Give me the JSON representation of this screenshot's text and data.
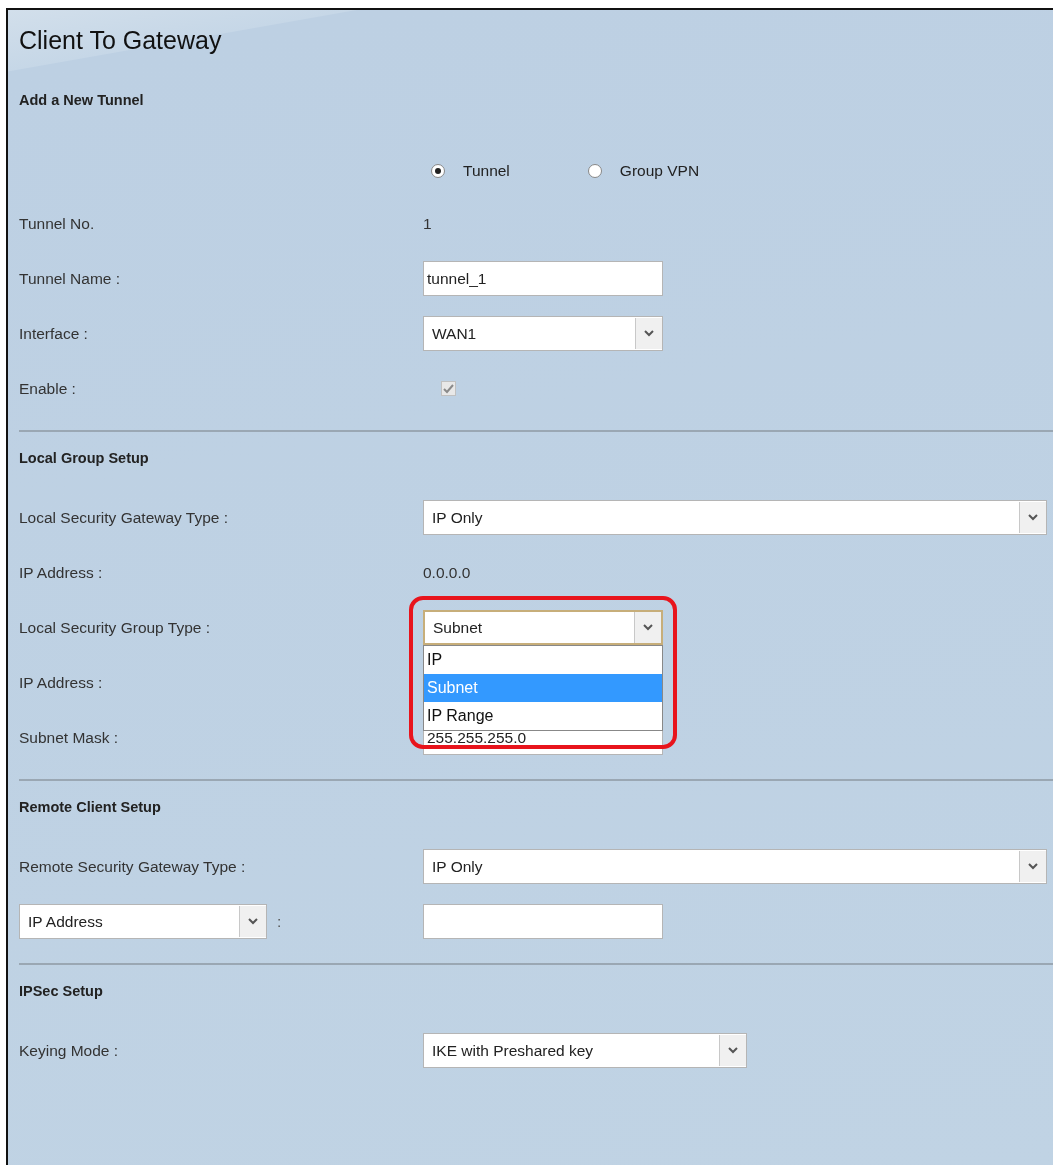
{
  "page": {
    "title": "Client To Gateway"
  },
  "sections": [
    {
      "heading": "Add a New Tunnel",
      "fields": [
        {
          "kind": "radio",
          "options": [
            {
              "label": "Tunnel",
              "selected": true
            },
            {
              "label": "Group VPN",
              "selected": false
            }
          ]
        },
        {
          "kind": "text",
          "label": "Tunnel No.",
          "value": "1"
        },
        {
          "kind": "input",
          "label": "Tunnel Name :",
          "value": "tunnel_1"
        },
        {
          "kind": "select",
          "label": "Interface :",
          "value": "WAN1"
        },
        {
          "kind": "checkbox",
          "label": "Enable :",
          "checked": true,
          "disabled": true
        }
      ]
    },
    {
      "heading": "Local Group Setup",
      "fields": [
        {
          "kind": "select",
          "label": "Local Security Gateway Type :",
          "value": "IP Only"
        },
        {
          "kind": "text",
          "label": "IP Address :",
          "value": "0.0.0.0"
        },
        {
          "kind": "select",
          "label": "Local Security Group Type :",
          "value": "Subnet",
          "expanded": true,
          "highlighted": true,
          "options": [
            {
              "label": "IP",
              "selected": false
            },
            {
              "label": "Subnet",
              "selected": true
            },
            {
              "label": "IP Range",
              "selected": false
            }
          ]
        },
        {
          "kind": "input",
          "label": "IP Address :"
        },
        {
          "kind": "input",
          "label": "Subnet Mask :",
          "value": "255.255.255.0"
        }
      ]
    },
    {
      "heading": "Remote Client Setup",
      "fields": [
        {
          "kind": "select",
          "label": "Remote Security Gateway Type :",
          "value": "IP Only"
        },
        {
          "kind": "select-label",
          "label_value": "IP Address",
          "separator": ":"
        }
      ]
    },
    {
      "heading": "IPSec Setup",
      "fields": [
        {
          "kind": "select",
          "label": "Keying Mode :",
          "value": "IKE with Preshared key"
        }
      ]
    }
  ]
}
